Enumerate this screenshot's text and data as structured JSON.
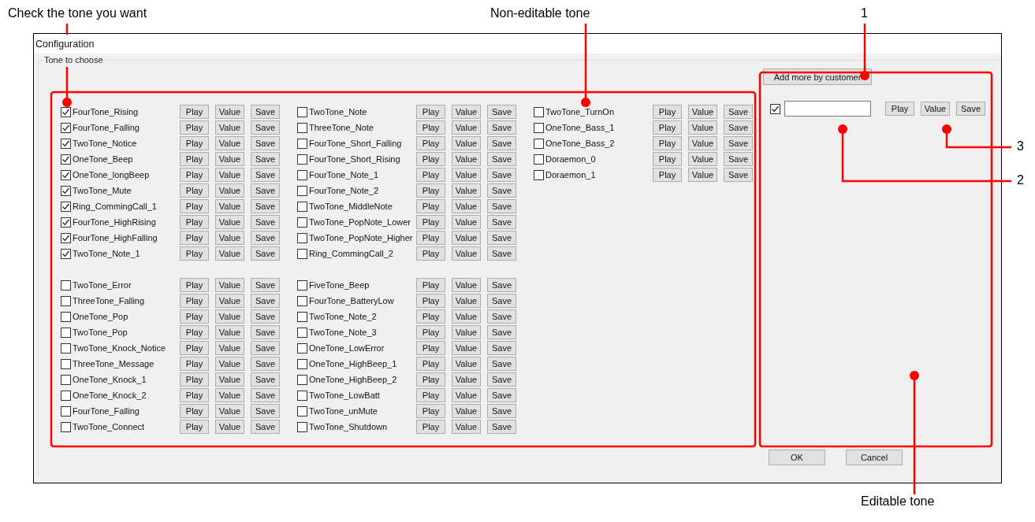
{
  "annotations": [
    {
      "text": "Check the tone you want"
    },
    {
      "text": "Non-editable tone"
    },
    {
      "text": "1"
    },
    {
      "text": "3"
    },
    {
      "text": "2"
    },
    {
      "text": "Editable tone"
    }
  ],
  "window": {
    "title": "Configuration"
  },
  "group": {
    "title": "Tone to choose"
  },
  "tone_columns": [
    {
      "groups": [
        [
          {
            "label": "FourTone_Rising",
            "checked": true,
            "buttons": [
              "Play",
              "Value",
              "Save"
            ]
          },
          {
            "label": "FourTone_Falling",
            "checked": true,
            "buttons": [
              "Play",
              "Value",
              "Save"
            ]
          },
          {
            "label": "TwoTone_Notice",
            "checked": true,
            "buttons": [
              "Play",
              "Value",
              "Save"
            ]
          },
          {
            "label": "OneTone_Beep",
            "checked": true,
            "buttons": [
              "Play",
              "Value",
              "Save"
            ]
          },
          {
            "label": "OneTone_longBeep",
            "checked": true,
            "buttons": [
              "Play",
              "Value",
              "Save"
            ]
          },
          {
            "label": "TwoTone_Mute",
            "checked": true,
            "buttons": [
              "Play",
              "Value",
              "Save"
            ]
          },
          {
            "label": "Ring_CommingCall_1",
            "checked": true,
            "buttons": [
              "Play",
              "Value",
              "Save"
            ]
          },
          {
            "label": "FourTone_HighRising",
            "checked": true,
            "buttons": [
              "Play",
              "Value",
              "Save"
            ]
          },
          {
            "label": "FourTone_HighFalling",
            "checked": true,
            "buttons": [
              "Play",
              "Value",
              "Save"
            ]
          },
          {
            "label": "TwoTone_Note_1",
            "checked": true,
            "buttons": [
              "Play",
              "Value",
              "Save"
            ]
          }
        ],
        [
          {
            "label": "TwoTone_Error",
            "checked": false,
            "buttons": [
              "Play",
              "Value",
              "Save"
            ]
          },
          {
            "label": "ThreeTone_Falling",
            "checked": false,
            "buttons": [
              "Play",
              "Value",
              "Save"
            ]
          },
          {
            "label": "OneTone_Pop",
            "checked": false,
            "buttons": [
              "Play",
              "Value",
              "Save"
            ]
          },
          {
            "label": "TwoTone_Pop",
            "checked": false,
            "buttons": [
              "Play",
              "Value",
              "Save"
            ]
          },
          {
            "label": "TwoTone_Knock_Notice",
            "checked": false,
            "buttons": [
              "Play",
              "Value",
              "Save"
            ]
          },
          {
            "label": "ThreeTone_Message",
            "checked": false,
            "buttons": [
              "Play",
              "Value",
              "Save"
            ]
          },
          {
            "label": "OneTone_Knock_1",
            "checked": false,
            "buttons": [
              "Play",
              "Value",
              "Save"
            ]
          },
          {
            "label": "OneTone_Knock_2",
            "checked": false,
            "buttons": [
              "Play",
              "Value",
              "Save"
            ]
          },
          {
            "label": "FourTone_Falling",
            "checked": false,
            "buttons": [
              "Play",
              "Value",
              "Save"
            ]
          },
          {
            "label": "TwoTone_Connect",
            "checked": false,
            "buttons": [
              "Play",
              "Value",
              "Save"
            ]
          }
        ]
      ]
    },
    {
      "groups": [
        [
          {
            "label": "TwoTone_Note",
            "checked": false,
            "buttons": [
              "Play",
              "Value",
              "Save"
            ]
          },
          {
            "label": "ThreeTone_Note",
            "checked": false,
            "buttons": [
              "Play",
              "Value",
              "Save"
            ]
          },
          {
            "label": "FourTone_Short_Falling",
            "checked": false,
            "buttons": [
              "Play",
              "Value",
              "Save"
            ]
          },
          {
            "label": "FourTone_Short_Rising",
            "checked": false,
            "buttons": [
              "Play",
              "Value",
              "Save"
            ]
          },
          {
            "label": "FourTone_Note_1",
            "checked": false,
            "buttons": [
              "Play",
              "Value",
              "Save"
            ]
          },
          {
            "label": "FourTone_Note_2",
            "checked": false,
            "buttons": [
              "Play",
              "Value",
              "Save"
            ]
          },
          {
            "label": "TwoTone_MiddleNote",
            "checked": false,
            "buttons": [
              "Play",
              "Value",
              "Save"
            ]
          },
          {
            "label": "TwoTone_PopNote_Lower",
            "checked": false,
            "buttons": [
              "Play",
              "Value",
              "Save"
            ]
          },
          {
            "label": "TwoTone_PopNote_Higher",
            "checked": false,
            "buttons": [
              "Play",
              "Value",
              "Save"
            ]
          },
          {
            "label": "Ring_CommingCall_2",
            "checked": false,
            "buttons": [
              "Play",
              "Value",
              "Save"
            ]
          }
        ],
        [
          {
            "label": "FiveTone_Beep",
            "checked": false,
            "buttons": [
              "Play",
              "Value",
              "Save"
            ]
          },
          {
            "label": "FourTone_BatteryLow",
            "checked": false,
            "buttons": [
              "Play",
              "Value",
              "Save"
            ]
          },
          {
            "label": "TwoTone_Note_2",
            "checked": false,
            "buttons": [
              "Play",
              "Value",
              "Save"
            ]
          },
          {
            "label": "TwoTone_Note_3",
            "checked": false,
            "buttons": [
              "Play",
              "Value",
              "Save"
            ]
          },
          {
            "label": "OneTone_LowError",
            "checked": false,
            "buttons": [
              "Play",
              "Value",
              "Save"
            ]
          },
          {
            "label": "OneTone_HighBeep_1",
            "checked": false,
            "buttons": [
              "Play",
              "Value",
              "Save"
            ]
          },
          {
            "label": "OneTone_HighBeep_2",
            "checked": false,
            "buttons": [
              "Play",
              "Value",
              "Save"
            ]
          },
          {
            "label": "TwoTone_LowBatt",
            "checked": false,
            "buttons": [
              "Play",
              "Value",
              "Save"
            ]
          },
          {
            "label": "TwoTone_unMute",
            "checked": false,
            "buttons": [
              "Play",
              "Value",
              "Save"
            ]
          },
          {
            "label": "TwoTone_Shutdown",
            "checked": false,
            "buttons": [
              "Play",
              "Value",
              "Save"
            ]
          }
        ]
      ]
    },
    {
      "groups": [
        [
          {
            "label": "TwoTone_TurnOn",
            "checked": false,
            "buttons": [
              "Play",
              "Value",
              "Save"
            ]
          },
          {
            "label": "OneTone_Bass_1",
            "checked": false,
            "buttons": [
              "Play",
              "Value",
              "Save"
            ]
          },
          {
            "label": "OneTone_Bass_2",
            "checked": false,
            "buttons": [
              "Play",
              "Value",
              "Save"
            ]
          },
          {
            "label": "Doraemon_0",
            "checked": false,
            "buttons": [
              "Play",
              "Value",
              "Save"
            ]
          },
          {
            "label": "Doraemon_1",
            "checked": false,
            "buttons": [
              "Play",
              "Value",
              "Save"
            ]
          }
        ]
      ]
    }
  ],
  "custom_panel": {
    "add_button": "Add more by customer",
    "rows": [
      {
        "checked": true,
        "buttons": [
          "Play",
          "Value",
          "Save"
        ]
      }
    ]
  },
  "footer_buttons": [
    "OK",
    "Cancel"
  ]
}
